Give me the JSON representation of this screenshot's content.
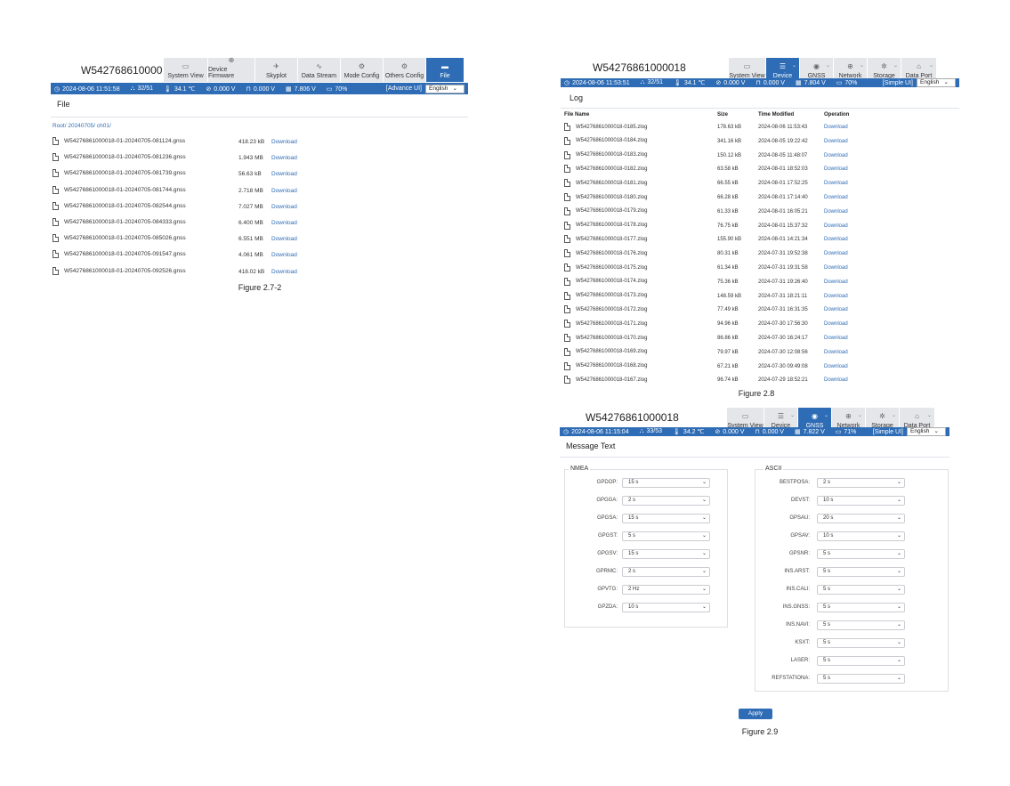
{
  "serial": "W54276861000018",
  "fig1": {
    "tabs": [
      {
        "label": "System View",
        "icon": "monitor-icon"
      },
      {
        "label": "Device Firmware",
        "icon": "firmware-icon"
      },
      {
        "label": "Skyplot",
        "icon": "satellite-icon"
      },
      {
        "label": "Data Stream",
        "icon": "stream-icon"
      },
      {
        "label": "Mode Config",
        "icon": "gear-icon"
      },
      {
        "label": "Others Config",
        "icon": "settings-icon"
      },
      {
        "label": "File",
        "icon": "folder-icon"
      }
    ],
    "status": {
      "datetime": "2024-08-06 11:51:58",
      "sats": "32/51",
      "temp": "34.1 ℃",
      "v1": "0.000 V",
      "v2": "0.000 V",
      "v3": "7.806 V",
      "battery": "70%",
      "ui_switch": "[Advance UI]",
      "language": "English"
    },
    "title": "File",
    "breadcrumb": "Root/ 20240705/ ch01/",
    "files": [
      {
        "name": "W54276861000018-01-20240705-081124.gnss",
        "size": "418.23 kB",
        "action": "Download"
      },
      {
        "name": "W54276861000018-01-20240705-081236.gnss",
        "size": "1.943 MB",
        "action": "Download"
      },
      {
        "name": "W54276861000018-01-20240705-081739.gnss",
        "size": "56.63 kB",
        "action": "Download"
      },
      {
        "name": "W54276861000018-01-20240705-081744.gnss",
        "size": "2.718 MB",
        "action": "Download"
      },
      {
        "name": "W54276861000018-01-20240705-082544.gnss",
        "size": "7.027 MB",
        "action": "Download"
      },
      {
        "name": "W54276861000018-01-20240705-084333.gnss",
        "size": "6.400 MB",
        "action": "Download"
      },
      {
        "name": "W54276861000018-01-20240705-085026.gnss",
        "size": "6.551 MB",
        "action": "Download"
      },
      {
        "name": "W54276861000018-01-20240705-091547.gnss",
        "size": "4.061 MB",
        "action": "Download"
      },
      {
        "name": "W54276861000018-01-20240705-092526.gnss",
        "size": "418.02 kB",
        "action": "Download"
      }
    ],
    "caption": "Figure 2.7-2"
  },
  "fig2": {
    "tabs": [
      {
        "label": "System View",
        "icon": "monitor-icon",
        "chevron": false
      },
      {
        "label": "Device",
        "icon": "device-icon",
        "chevron": true
      },
      {
        "label": "GNSS",
        "icon": "location-pin-icon",
        "chevron": true
      },
      {
        "label": "Network",
        "icon": "globe-icon",
        "chevron": true
      },
      {
        "label": "Storage",
        "icon": "storage-icon",
        "chevron": true
      },
      {
        "label": "Data Port",
        "icon": "data-port-icon",
        "chevron": true
      }
    ],
    "status": {
      "datetime": "2024-08-06 11:53:51",
      "sats": "32/51",
      "temp": "34.1 ℃",
      "v1": "0.000 V",
      "v2": "0.000 V",
      "v3": "7.804 V",
      "battery": "70%",
      "ui_switch": "[Simple UI]",
      "language": "English"
    },
    "title": "Log",
    "headers": {
      "name": "File Name",
      "size": "Size",
      "time": "Time Modified",
      "op": "Operation"
    },
    "rows": [
      {
        "name": "W54276861000018-0185.zlog",
        "size": "178.63 kB",
        "time": "2024-08-06 11:53:43",
        "op": "Download"
      },
      {
        "name": "W54276861000018-0184.zlog",
        "size": "341.16 kB",
        "time": "2024-08-05 19:22:42",
        "op": "Download"
      },
      {
        "name": "W54276861000018-0183.zlog",
        "size": "150.12 kB",
        "time": "2024-08-05 11:48:07",
        "op": "Download"
      },
      {
        "name": "W54276861000018-0182.zlog",
        "size": "63.58 kB",
        "time": "2024-08-01 18:52:03",
        "op": "Download"
      },
      {
        "name": "W54276861000018-0181.zlog",
        "size": "66.55 kB",
        "time": "2024-08-01 17:52:25",
        "op": "Download"
      },
      {
        "name": "W54276861000018-0180.zlog",
        "size": "66.28 kB",
        "time": "2024-08-01 17:14:40",
        "op": "Download"
      },
      {
        "name": "W54276861000018-0179.zlog",
        "size": "61.33 kB",
        "time": "2024-08-01 16:05:21",
        "op": "Download"
      },
      {
        "name": "W54276861000018-0178.zlog",
        "size": "76.75 kB",
        "time": "2024-08-01 15:37:32",
        "op": "Download"
      },
      {
        "name": "W54276861000018-0177.zlog",
        "size": "155.90 kB",
        "time": "2024-08-01 14:21:34",
        "op": "Download"
      },
      {
        "name": "W54276861000018-0176.zlog",
        "size": "80.31 kB",
        "time": "2024-07-31 19:52:38",
        "op": "Download"
      },
      {
        "name": "W54276861000018-0175.zlog",
        "size": "61.34 kB",
        "time": "2024-07-31 19:31:58",
        "op": "Download"
      },
      {
        "name": "W54276861000018-0174.zlog",
        "size": "75.36 kB",
        "time": "2024-07-31 19:26:40",
        "op": "Download"
      },
      {
        "name": "W54276861000018-0173.zlog",
        "size": "148.59 kB",
        "time": "2024-07-31 18:21:11",
        "op": "Download"
      },
      {
        "name": "W54276861000018-0172.zlog",
        "size": "77.49 kB",
        "time": "2024-07-31 16:31:35",
        "op": "Download"
      },
      {
        "name": "W54276861000018-0171.zlog",
        "size": "94.96 kB",
        "time": "2024-07-30 17:56:30",
        "op": "Download"
      },
      {
        "name": "W54276861000018-0170.zlog",
        "size": "86.86 kB",
        "time": "2024-07-30 16:24:17",
        "op": "Download"
      },
      {
        "name": "W54276861000018-0169.zlog",
        "size": "79.97 kB",
        "time": "2024-07-30 12:08:56",
        "op": "Download"
      },
      {
        "name": "W54276861000018-0168.zlog",
        "size": "67.21 kB",
        "time": "2024-07-30 09:49:08",
        "op": "Download"
      },
      {
        "name": "W54276861000018-0167.zlog",
        "size": "96.74 kB",
        "time": "2024-07-29 18:52:21",
        "op": "Download"
      }
    ],
    "caption": "Figure 2.8"
  },
  "fig3": {
    "tabs": [
      {
        "label": "System View",
        "icon": "monitor-icon",
        "chevron": false
      },
      {
        "label": "Device",
        "icon": "device-icon",
        "chevron": true
      },
      {
        "label": "GNSS",
        "icon": "location-pin-icon",
        "chevron": true
      },
      {
        "label": "Network",
        "icon": "globe-icon",
        "chevron": true
      },
      {
        "label": "Storage",
        "icon": "storage-icon",
        "chevron": true
      },
      {
        "label": "Data Port",
        "icon": "data-port-icon",
        "chevron": true
      }
    ],
    "status": {
      "datetime": "2024-08-06 11:15:04",
      "sats": "33/53",
      "temp": "34.2 ℃",
      "v1": "0.000 V",
      "v2": "0.000 V",
      "v3": "7.822 V",
      "battery": "71%",
      "ui_switch": "[Simple UI]",
      "language": "English"
    },
    "title": "Message Text",
    "nmea_legend": "NMEA",
    "ascii_legend": "ASCII",
    "nmea": [
      {
        "label": "GPDOP:",
        "value": "15 s"
      },
      {
        "label": "GPGGA:",
        "value": "2 s"
      },
      {
        "label": "GPGSA:",
        "value": "15 s"
      },
      {
        "label": "GPGST:",
        "value": "5 s"
      },
      {
        "label": "GPGSV:",
        "value": "15 s"
      },
      {
        "label": "GPRMC:",
        "value": "2 s"
      },
      {
        "label": "GPVTG:",
        "value": "2 Hz"
      },
      {
        "label": "GPZDA:",
        "value": "10 s"
      }
    ],
    "ascii": [
      {
        "label": "BESTPOSA:",
        "value": "2 s"
      },
      {
        "label": "DEVST:",
        "value": "10 s"
      },
      {
        "label": "GPSAU:",
        "value": "20 s"
      },
      {
        "label": "GPSAV:",
        "value": "10 s"
      },
      {
        "label": "GPSNR:",
        "value": "5 s"
      },
      {
        "label": "INS.ARST:",
        "value": "5 s"
      },
      {
        "label": "INS.CALI:",
        "value": "5 s"
      },
      {
        "label": "INS.GNSS:",
        "value": "5 s"
      },
      {
        "label": "INS.NAVI:",
        "value": "5 s"
      },
      {
        "label": "KSXT:",
        "value": "5 s"
      },
      {
        "label": "LASER:",
        "value": "5 s"
      },
      {
        "label": "REFSTATIONA:",
        "value": "5 s"
      }
    ],
    "apply": "Apply",
    "caption": "Figure 2.9"
  },
  "colors": {
    "accent": "#2e6cb5",
    "tab_bg": "#e4e6ea"
  }
}
